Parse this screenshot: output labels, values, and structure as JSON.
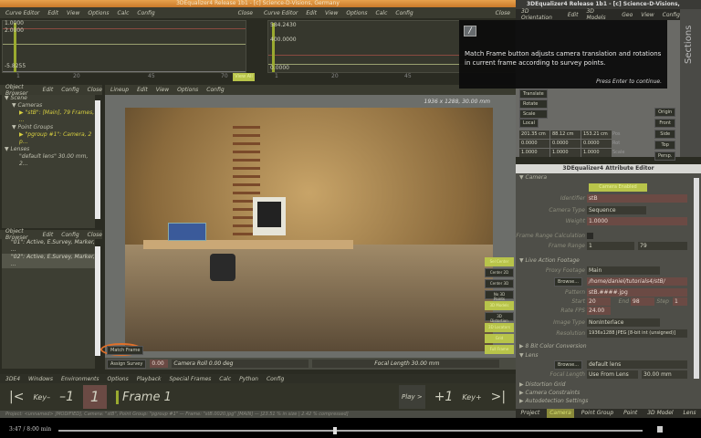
{
  "main_window": {
    "title": "3DEqualizer4 Release 1b1  -  [c] Science-D-Visions, Germany"
  },
  "curve_editor_left": {
    "menu": [
      "Curve Editor",
      "Edit",
      "View",
      "Options",
      "Calc",
      "Config"
    ],
    "close": "Close",
    "y_labels": [
      "1.0000",
      "2.0000",
      "-5.8255"
    ],
    "x_labels": [
      "1",
      "20",
      "45",
      "70"
    ],
    "view_all": "View All"
  },
  "curve_editor_right": {
    "menu": [
      "Curve Editor",
      "Edit",
      "View",
      "Options",
      "Calc",
      "Config"
    ],
    "close": "Close",
    "y_labels": [
      "584.2430",
      "400.0000",
      "0.0000"
    ],
    "x_labels": [
      "1",
      "20",
      "45"
    ]
  },
  "object_browser": {
    "menu": [
      "Object Browser",
      "Edit",
      "Config",
      "Close"
    ],
    "tree": [
      {
        "label": "Scene",
        "level": 0
      },
      {
        "label": "Cameras",
        "level": 1
      },
      {
        "label": "\"stB\": [Main], 79 Frames, ...",
        "level": 2,
        "highlight": true
      },
      {
        "label": "Point Groups",
        "level": 1
      },
      {
        "label": "\"pgroup #1\": Camera, 2 p...",
        "level": 2,
        "highlight": true
      },
      {
        "label": "Lenses",
        "level": 0
      },
      {
        "label": "\"default lens\"  30.00 mm, 2...",
        "level": 2
      }
    ]
  },
  "object_browser2": {
    "menu": [
      "Object Browser",
      "Edit",
      "Config",
      "Close"
    ],
    "items": [
      "\"01\": Active, E.Survey, Marker, ...",
      "\"02\": Active, E.Survey, Marker, ..."
    ]
  },
  "lineup": {
    "menu": [
      "Lineup",
      "Edit",
      "View",
      "Options",
      "Config"
    ],
    "resolution_label": "1936 x 1288, 30.00 mm",
    "side_buttons": [
      "Sel Center",
      "Center 2D",
      "Center 3D",
      "No 3D Points",
      "3D Models",
      "3D Distortion",
      "3D Locators",
      "Grid",
      "Full Frame"
    ],
    "match_frame": "Match Frame",
    "assign_survey": "Assign Survey",
    "value": "0.00",
    "camera_roll": "Camera Roll 0.00 deg",
    "focal_length": "Focal Length 30.00 mm"
  },
  "main_menu": [
    "3DE4",
    "Windows",
    "Environments",
    "Options",
    "Playback",
    "Special Frames",
    "Calc",
    "Python",
    "Config"
  ],
  "timeline": {
    "first": "|<",
    "key_prev": "Key–",
    "minus_one": "–1",
    "frame_value": "1",
    "frame_label": "Frame 1",
    "play": "Play >",
    "plus_one": "+1",
    "key_next": "Key+",
    "last": ">|"
  },
  "status": "Project: <unnamed> [MODIFIED], Camera: \"stB\", Point Group: \"pgroup #1\" — Frame: \"stB.0020.jpg\" [MAIN] — [23.51 % in size | 2.42 % compressed]",
  "orientation_window": {
    "title": "3DEqualizer4 Release 1b1  -  [c] Science-D-Visions,",
    "menu": [
      "3D Orientation",
      "Edit",
      "3D Models",
      "Geo",
      "View",
      "Config"
    ],
    "mode_buttons": [
      "Translate",
      "Rotate",
      "Scale"
    ],
    "local": "Local",
    "rows": [
      {
        "values": [
          "201.35 cm",
          "88.12 cm",
          "153.21 cm"
        ],
        "label": "Pos"
      },
      {
        "values": [
          "0.0000",
          "0.0000",
          "0.0000"
        ],
        "label": "Rot"
      },
      {
        "values": [
          "1.0000",
          "1.0000",
          "1.0000"
        ],
        "label": "Scale"
      }
    ],
    "view_buttons": [
      "Origin",
      "Front",
      "Side",
      "Top",
      "Persp."
    ],
    "sections_label": "Sections"
  },
  "tooltip": {
    "icon": "info-icon",
    "text": "Match Frame button adjusts camera translation and rotations in current frame according to survey points.",
    "hint": "Press Enter to continue."
  },
  "attribute_editor": {
    "title": "3DEqualizer4 Attribute Editor",
    "camera_section": "Camera",
    "camera_enabled": "Camera Enabled",
    "identifier_label": "Identifier",
    "identifier": "stB",
    "camera_type_label": "Camera Type",
    "camera_type": "Sequence",
    "weight_label": "Weight",
    "weight": "1.0000",
    "frc_label": "Frame Range Calculation",
    "frame_range_label": "Frame Range",
    "frame_start": "1",
    "frame_end": "79",
    "laf_section": "Live Action Footage",
    "proxy_label": "Proxy Footage",
    "proxy": "Main",
    "browse": "Browse...",
    "path": "/home/daniel/tutorials4/stB/",
    "pattern_label": "Pattern",
    "pattern": "stB.####.jpg",
    "start_label": "Start",
    "start": "20",
    "end_label": "End",
    "end": "98",
    "step_label": "Step",
    "step": "1",
    "fps_label": "Rate FPS",
    "fps": "24.00",
    "image_type_label": "Image Type",
    "image_type": "NonInterlace",
    "resolution_label": "Resolution",
    "resolution": "1936x1288 JPEG [8-bit int (unsigned)]",
    "color_section": "8 Bit Color Conversion",
    "lens_section": "Lens",
    "lens_browse": "Browse...",
    "lens": "default lens",
    "focal_label": "Focal Length",
    "focal_mode": "Use From Lens",
    "focal": "30.00 mm",
    "more_sections": [
      "Distortion Grid",
      "Camera Constraints",
      "Autodetection Settings"
    ],
    "tabs": [
      "Project",
      "Camera",
      "Point Group",
      "Point",
      "3D Model",
      "Lens"
    ],
    "active_tab": "Camera"
  },
  "player": {
    "time": "3:47 / 8:00 min",
    "progress": 0.47
  },
  "colors": {
    "accent": "#b8c44a",
    "title_orange": "#d88a34",
    "field_red": "#6b4a44",
    "highlight_circle": "#e0702a"
  }
}
